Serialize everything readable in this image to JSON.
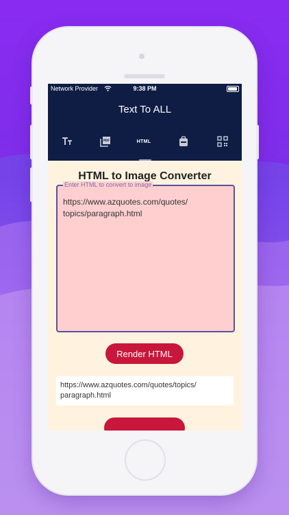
{
  "status_bar": {
    "carrier": "Network Provider",
    "time": "9:38 PM"
  },
  "app": {
    "title": "Text To ALL"
  },
  "tabs": [
    {
      "icon": "text-icon"
    },
    {
      "icon": "pdf-icon"
    },
    {
      "label": "HTML",
      "icon": "html-icon",
      "active": true
    },
    {
      "icon": "backpack-icon"
    },
    {
      "icon": "qr-code-icon"
    }
  ],
  "page": {
    "heading": "HTML to Image Converter",
    "input_label": "Enter HTML to convert to image",
    "input_value": "https://www.azquotes.com/quotes/\ntopics/paragraph.html",
    "render_button": "Render HTML",
    "output_text": "https://www.azquotes.com/quotes/topics/\nparagraph.html"
  },
  "colors": {
    "appbar": "#0f1d45",
    "accent": "#c8173a",
    "input_fill": "#ffcfd0",
    "screen_bg": "#fff3e0"
  }
}
